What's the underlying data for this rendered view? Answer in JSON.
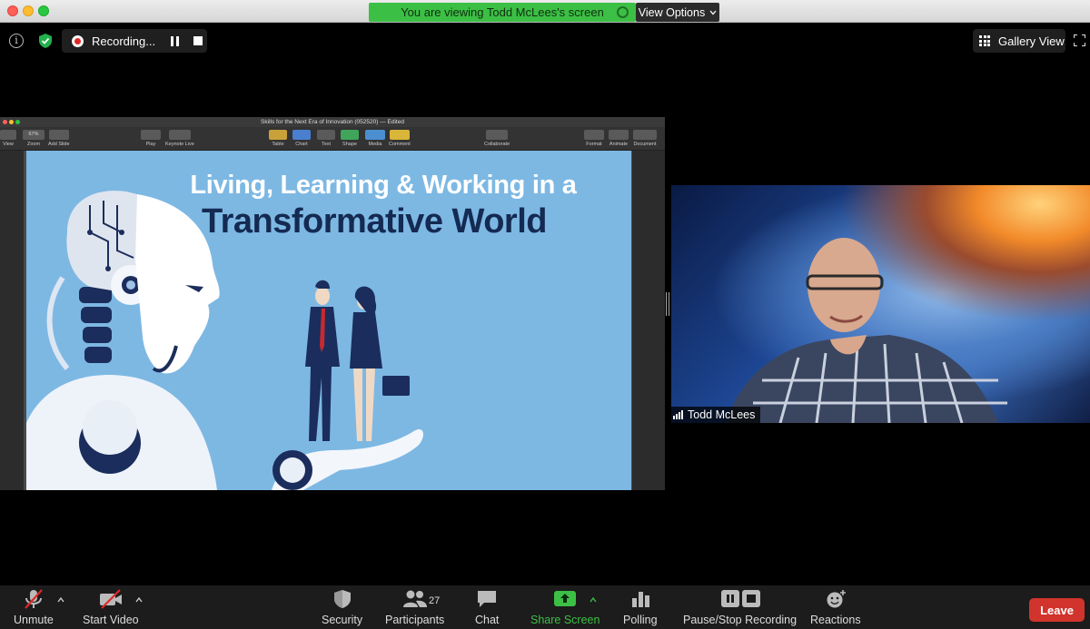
{
  "banner": {
    "viewing_text": "You are viewing Todd McLees's screen",
    "view_options_label": "View Options"
  },
  "top_bar": {
    "recording_label": "Recording...",
    "gallery_view_label": "Gallery View"
  },
  "keynote": {
    "document_title": "Skills for the Next Era of Innovation (052520) — Edited",
    "zoom_value": "67%",
    "toolbar_labels": {
      "view": "View",
      "zoom": "Zoom",
      "add_slide": "Add Slide",
      "play": "Play",
      "keynote_live": "Keynote Live",
      "table": "Table",
      "chart": "Chart",
      "text": "Text",
      "shape": "Shape",
      "media": "Media",
      "comment": "Comment",
      "collaborate": "Collaborate",
      "format": "Format",
      "animate": "Animate",
      "document": "Document"
    },
    "slide": {
      "title_line_1": "Living, Learning & Working in a",
      "title_line_2": "Transformative World"
    }
  },
  "participant": {
    "name": "Todd McLees"
  },
  "toolbar": {
    "unmute": "Unmute",
    "start_video": "Start Video",
    "security": "Security",
    "participants": "Participants",
    "participants_count": "27",
    "chat": "Chat",
    "share_screen": "Share Screen",
    "polling": "Polling",
    "pause_stop_recording": "Pause/Stop Recording",
    "reactions": "Reactions",
    "leave": "Leave"
  },
  "colors": {
    "share_green": "#3cbf45",
    "leave_red": "#d1342c",
    "recording_red": "#e02828",
    "slide_blue": "#7db8e3",
    "slide_navy": "#142a52"
  }
}
